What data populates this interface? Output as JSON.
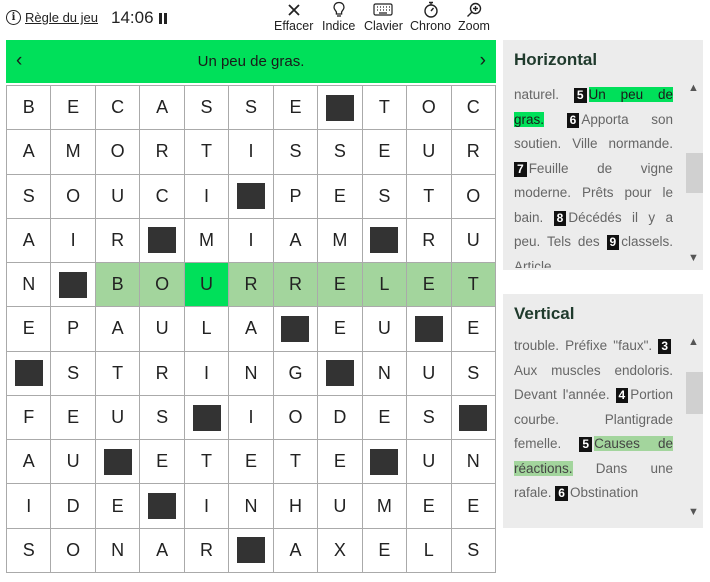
{
  "toolbar": {
    "rules_label": "Règle du jeu",
    "time": "14:06",
    "tools": [
      {
        "label": "Effacer",
        "icon": "close-icon"
      },
      {
        "label": "Indice",
        "icon": "lightbulb-icon"
      },
      {
        "label": "Clavier",
        "icon": "keyboard-icon"
      },
      {
        "label": "Chrono",
        "icon": "stopwatch-icon"
      },
      {
        "label": "Zoom",
        "icon": "zoom-icon"
      }
    ]
  },
  "current_clue": "Un peu de gras.",
  "grid": {
    "rows": [
      [
        "B",
        "E",
        "C",
        "A",
        "S",
        "S",
        "E",
        "#",
        "T",
        "O",
        "C"
      ],
      [
        "A",
        "M",
        "O",
        "R",
        "T",
        "I",
        "S",
        "S",
        "E",
        "U",
        "R"
      ],
      [
        "S",
        "O",
        "U",
        "C",
        "I",
        "#",
        "P",
        "E",
        "S",
        "T",
        "O"
      ],
      [
        "A",
        "I",
        "R",
        "#",
        "M",
        "I",
        "A",
        "M",
        "#",
        "R",
        "U"
      ],
      [
        "N",
        "#",
        "B",
        "O",
        "U",
        "R",
        "R",
        "E",
        "L",
        "E",
        "T"
      ],
      [
        "E",
        "P",
        "A",
        "U",
        "L",
        "A",
        "#",
        "E",
        "U",
        "#",
        "E"
      ],
      [
        "#",
        "S",
        "T",
        "R",
        "I",
        "N",
        "G",
        "#",
        "N",
        "U",
        "S"
      ],
      [
        "F",
        "E",
        "U",
        "S",
        "#",
        "I",
        "O",
        "D",
        "E",
        "S",
        "#"
      ],
      [
        "A",
        "U",
        "#",
        "E",
        "T",
        "E",
        "T",
        "E",
        "#",
        "U",
        "N"
      ],
      [
        "I",
        "D",
        "E",
        "#",
        "I",
        "N",
        "H",
        "U",
        "M",
        "E",
        "E"
      ],
      [
        "S",
        "O",
        "N",
        "A",
        "R",
        "#",
        "A",
        "X",
        "E",
        "L",
        "S"
      ]
    ],
    "highlight_row": 4,
    "highlight_from_col": 2,
    "cursor": {
      "row": 4,
      "col": 4
    }
  },
  "horizontal": {
    "title": "Horizontal",
    "lead": "naturel.",
    "clues": [
      {
        "num": "5",
        "text": "Un peu de gras.",
        "state": "current"
      },
      {
        "num": "6",
        "text": "Apporta son soutien. Ville normande.",
        "state": ""
      },
      {
        "num": "7",
        "text": "Feuille de vigne moderne. Prêts pour le bain.",
        "state": ""
      },
      {
        "num": "8",
        "text": "Décédés il y a peu. Tels des",
        "state": ""
      },
      {
        "num": "9",
        "text": "classels. Article.",
        "state": ""
      }
    ]
  },
  "vertical": {
    "title": "Vertical",
    "lead": "trouble. Préfixe \"faux\".",
    "clues": [
      {
        "num": "3",
        "text": "Aux muscles endoloris. Devant l'année.",
        "state": ""
      },
      {
        "num": "4",
        "text": "Portion courbe. Plantigrade femelle.",
        "state": ""
      },
      {
        "num": "5",
        "text": "Causes de réactions.",
        "state": "selected"
      },
      {
        "num": "",
        "text": "Dans une rafale.",
        "state": ""
      },
      {
        "num": "6",
        "text": "Obstination",
        "state": ""
      }
    ]
  }
}
